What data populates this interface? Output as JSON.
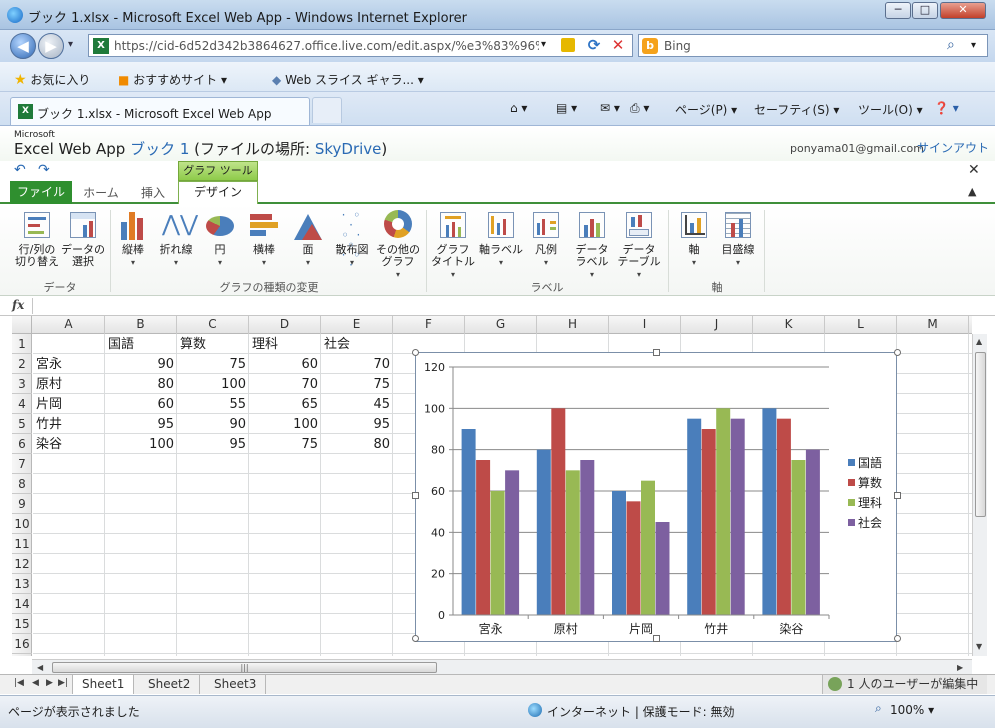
{
  "window": {
    "title": "ブック 1.xlsx - Microsoft Excel Web App - Windows Internet Explorer",
    "min": "─",
    "max": "□",
    "close": "✕"
  },
  "browser": {
    "back": "◀",
    "forward": "▶",
    "url": "https://cid-6d52d342b3864627.office.live.com/edit.aspx/%e3%83%96%",
    "search_placeholder": "Bing",
    "favorites": "お気に入り",
    "suggested_sites": "おすすめサイト ▾",
    "web_slice": "Web スライス ギャラ... ▾",
    "tab_title": "ブック 1.xlsx - Microsoft Excel Web App",
    "cmd_page": "ページ(P) ▾",
    "cmd_safety": "セーフティ(S) ▾",
    "cmd_tools": "ツール(O) ▾",
    "cmd_help": "❓ ▾"
  },
  "excel": {
    "ms_label": "Microsoft",
    "app_name": "Excel Web App",
    "doc_name": "ブック 1",
    "location_prefix": "(ファイルの場所: ",
    "location_link": "SkyDrive",
    "location_suffix": ")",
    "user_email": "ponyama01@gmail.com",
    "signout": "サインアウト",
    "context_tab": "グラフ ツール",
    "tabs": {
      "file": "ファイル",
      "home": "ホーム",
      "insert": "挿入",
      "design": "デザイン"
    }
  },
  "ribbon": {
    "buttons": [
      {
        "id": "switch-row-col",
        "label": "行/列の\n切り替え",
        "dropdown": false
      },
      {
        "id": "select-data",
        "label": "データの\n選択",
        "dropdown": false
      },
      {
        "id": "column-chart",
        "label": "縦棒",
        "dropdown": true
      },
      {
        "id": "line-chart",
        "label": "折れ線",
        "dropdown": true
      },
      {
        "id": "pie-chart",
        "label": "円",
        "dropdown": true
      },
      {
        "id": "bar-chart",
        "label": "横棒",
        "dropdown": true
      },
      {
        "id": "area-chart",
        "label": "面",
        "dropdown": true
      },
      {
        "id": "scatter-chart",
        "label": "散布図",
        "dropdown": true
      },
      {
        "id": "other-charts",
        "label": "その他の\nグラフ",
        "dropdown": true
      },
      {
        "id": "chart-title",
        "label": "グラフ\nタイトル",
        "dropdown": true
      },
      {
        "id": "axis-titles",
        "label": "軸ラベル",
        "dropdown": true
      },
      {
        "id": "legend",
        "label": "凡例",
        "dropdown": true
      },
      {
        "id": "data-labels",
        "label": "データ\nラベル",
        "dropdown": true
      },
      {
        "id": "data-table",
        "label": "データ\nテーブル",
        "dropdown": true
      },
      {
        "id": "axes",
        "label": "軸",
        "dropdown": true
      },
      {
        "id": "gridlines",
        "label": "目盛線",
        "dropdown": true
      }
    ],
    "groups": {
      "data": "データ",
      "type": "グラフの種類の変更",
      "labels": "ラベル",
      "axes": "軸"
    }
  },
  "formula_bar": {
    "fx": "fx",
    "value": ""
  },
  "grid": {
    "columns": [
      "A",
      "B",
      "C",
      "D",
      "E",
      "F",
      "G",
      "H",
      "I",
      "J",
      "K",
      "L",
      "M"
    ],
    "rows": [
      "1",
      "2",
      "3",
      "4",
      "5",
      "6",
      "7",
      "8",
      "9",
      "10",
      "11",
      "12",
      "13",
      "14",
      "15",
      "16"
    ],
    "header_row": [
      "",
      "国語",
      "算数",
      "理科",
      "社会"
    ],
    "data_rows": [
      [
        "宮永",
        "90",
        "75",
        "60",
        "70"
      ],
      [
        "原村",
        "80",
        "100",
        "70",
        "75"
      ],
      [
        "片岡",
        "60",
        "55",
        "65",
        "45"
      ],
      [
        "竹井",
        "95",
        "90",
        "100",
        "95"
      ],
      [
        "染谷",
        "100",
        "95",
        "75",
        "80"
      ]
    ]
  },
  "sheets": [
    "Sheet1",
    "Sheet2",
    "Sheet3"
  ],
  "editors": "1 人のユーザーが編集中 ▾",
  "status": {
    "text": "ページが表示されました",
    "zone": "インターネット | 保護モード: 無効",
    "zoom": "100%",
    "zoom_dd": "▾"
  },
  "colors": {
    "s1": "#4a7ebb",
    "s2": "#be4b48",
    "s3": "#98b954",
    "s4": "#7d60a0"
  },
  "chart_data": {
    "type": "bar",
    "categories": [
      "宮永",
      "原村",
      "片岡",
      "竹井",
      "染谷"
    ],
    "series": [
      {
        "name": "国語",
        "values": [
          90,
          80,
          60,
          95,
          100
        ]
      },
      {
        "name": "算数",
        "values": [
          75,
          100,
          55,
          90,
          95
        ]
      },
      {
        "name": "理科",
        "values": [
          60,
          70,
          65,
          100,
          75
        ]
      },
      {
        "name": "社会",
        "values": [
          70,
          75,
          45,
          95,
          80
        ]
      }
    ],
    "yticks": [
      "0",
      "20",
      "40",
      "60",
      "80",
      "100",
      "120"
    ],
    "ylim": [
      0,
      120
    ],
    "grid": true,
    "legend": "right"
  }
}
